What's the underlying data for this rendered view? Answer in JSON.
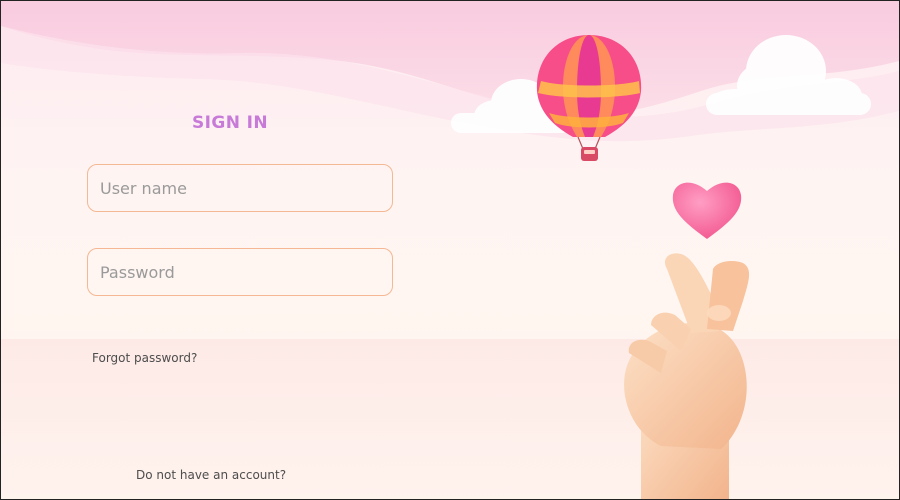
{
  "form": {
    "title": "SIGN IN",
    "username": {
      "placeholder": "User name",
      "value": ""
    },
    "password": {
      "placeholder": "Password",
      "value": ""
    },
    "forgot_password_label": "Forgot password?",
    "no_account_label": "Do not have an account?"
  },
  "colors": {
    "title": "#c77ad8",
    "field_border": "#f4b894",
    "link_text": "#4d4d4d",
    "background_top": "#fde8f0",
    "background_bottom": "#fff2ec"
  },
  "illustration": {
    "icons": [
      "hot-air-balloon-icon",
      "cloud-icon",
      "heart-icon",
      "finger-heart-hand-icon"
    ]
  }
}
